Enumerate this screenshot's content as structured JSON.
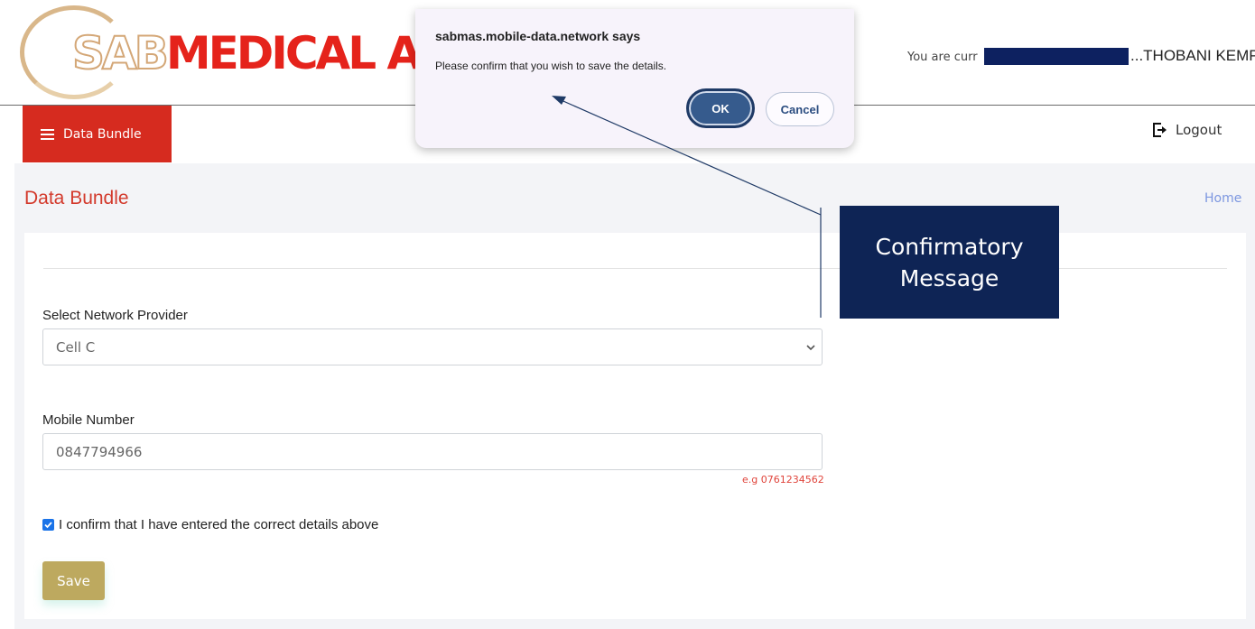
{
  "logo": {
    "part1": "SAB",
    "part2": "MEDICAL AID"
  },
  "header": {
    "user_prefix": "You are curr",
    "user_name": "...THOBANI KEMP"
  },
  "nav": {
    "menu_label": "Data Bundle",
    "logout_label": "Logout"
  },
  "page": {
    "title": "Data Bundle",
    "breadcrumb": "Home"
  },
  "form": {
    "network_label": "Select Network Provider",
    "network_value": "Cell C",
    "mobile_label": "Mobile Number",
    "mobile_value": "0847794966",
    "mobile_hint": "e.g 0761234562",
    "confirm_label": "I confirm that I have entered the correct details above",
    "confirm_checked": true,
    "save_label": "Save"
  },
  "dialog": {
    "title": "sabmas.mobile-data.network says",
    "message": "Please confirm that you wish to save the details.",
    "ok_label": "OK",
    "cancel_label": "Cancel"
  },
  "annotation": {
    "line1": "Confirmatory",
    "line2": "Message"
  },
  "colors": {
    "brand_red": "#d62b1f",
    "brand_gold": "#bda95f",
    "annotation_navy": "#0e2455"
  }
}
